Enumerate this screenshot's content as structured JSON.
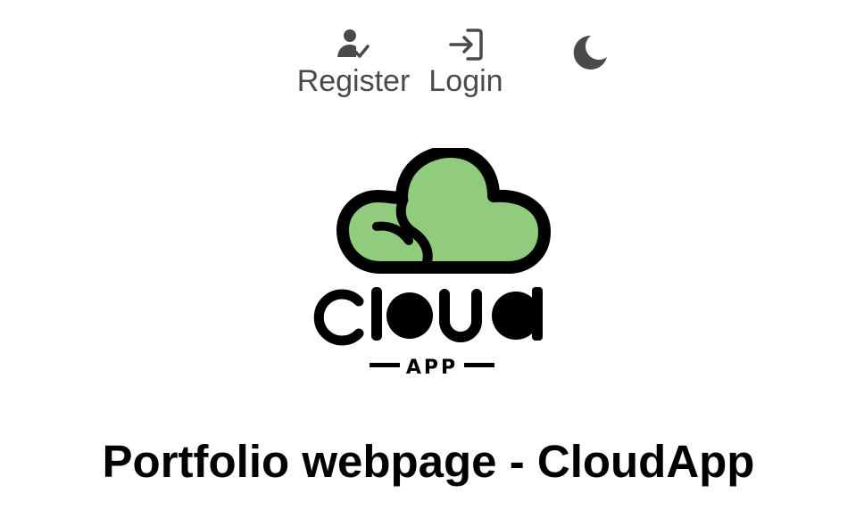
{
  "nav": {
    "register": {
      "label": "Register",
      "icon": "user-check-icon"
    },
    "login": {
      "label": "Login",
      "icon": "login-icon"
    },
    "theme_toggle": {
      "icon": "moon-icon"
    }
  },
  "logo": {
    "icon": "cloud-icon",
    "wordmark": "cloud",
    "tagline": "APP",
    "colors": {
      "fill": "#91cb7e",
      "outline": "#000000"
    }
  },
  "page": {
    "title": "Portfolio webpage - CloudApp"
  },
  "colors": {
    "nav_text": "#4a4a4a",
    "title": "#000000",
    "background": "#ffffff"
  }
}
